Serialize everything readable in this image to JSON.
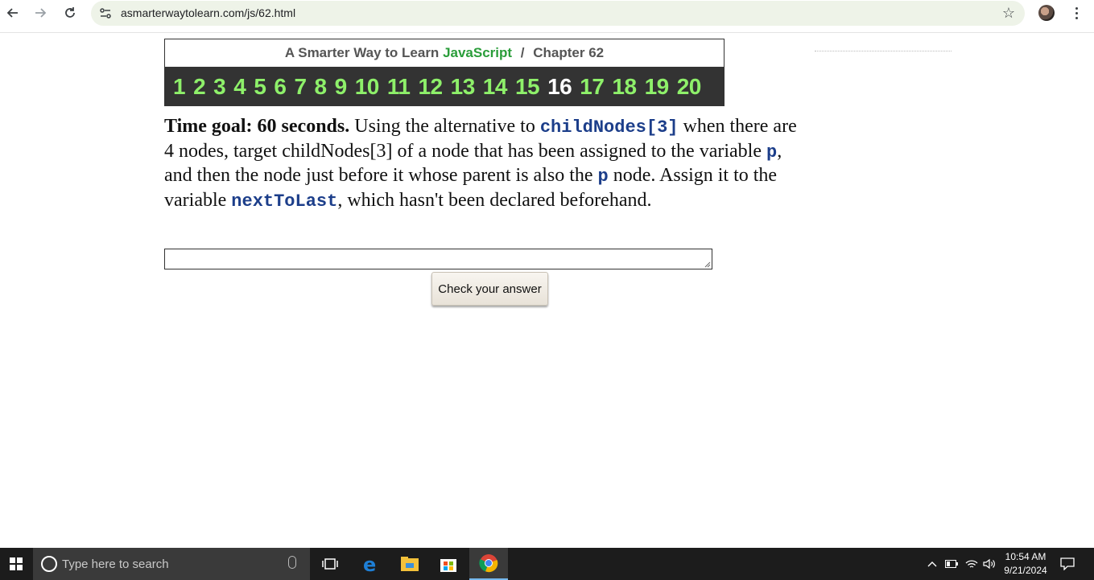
{
  "browser": {
    "url": "asmarterwaytolearn.com/js/62.html"
  },
  "header": {
    "prefix": "A Smarter Way to Learn",
    "brand": "JavaScript",
    "separator": "/",
    "chapter": "Chapter 62"
  },
  "chapters": [
    "1",
    "2",
    "3",
    "4",
    "5",
    "6",
    "7",
    "8",
    "9",
    "10",
    "11",
    "12",
    "13",
    "14",
    "15",
    "16",
    "17",
    "18",
    "19",
    "20"
  ],
  "current_chapter": "16",
  "question": {
    "goal": "Time goal: 60 seconds.",
    "t1": " Using the alternative to ",
    "c1": "childNodes[3]",
    "t2": " when there are 4 nodes, target childNodes[3] of a node that has been assigned to the variable ",
    "c2": "p",
    "t3": ", and then the node just before it whose parent is also the ",
    "c3": "p",
    "t4": " node. Assign it to the variable ",
    "c4": "nextToLast",
    "t5": ", which hasn't been declared beforehand."
  },
  "answer": {
    "value": ""
  },
  "check_button": "Check your answer",
  "taskbar": {
    "search_placeholder": "Type here to search",
    "time": "10:54 AM",
    "date": "9/21/2024"
  }
}
